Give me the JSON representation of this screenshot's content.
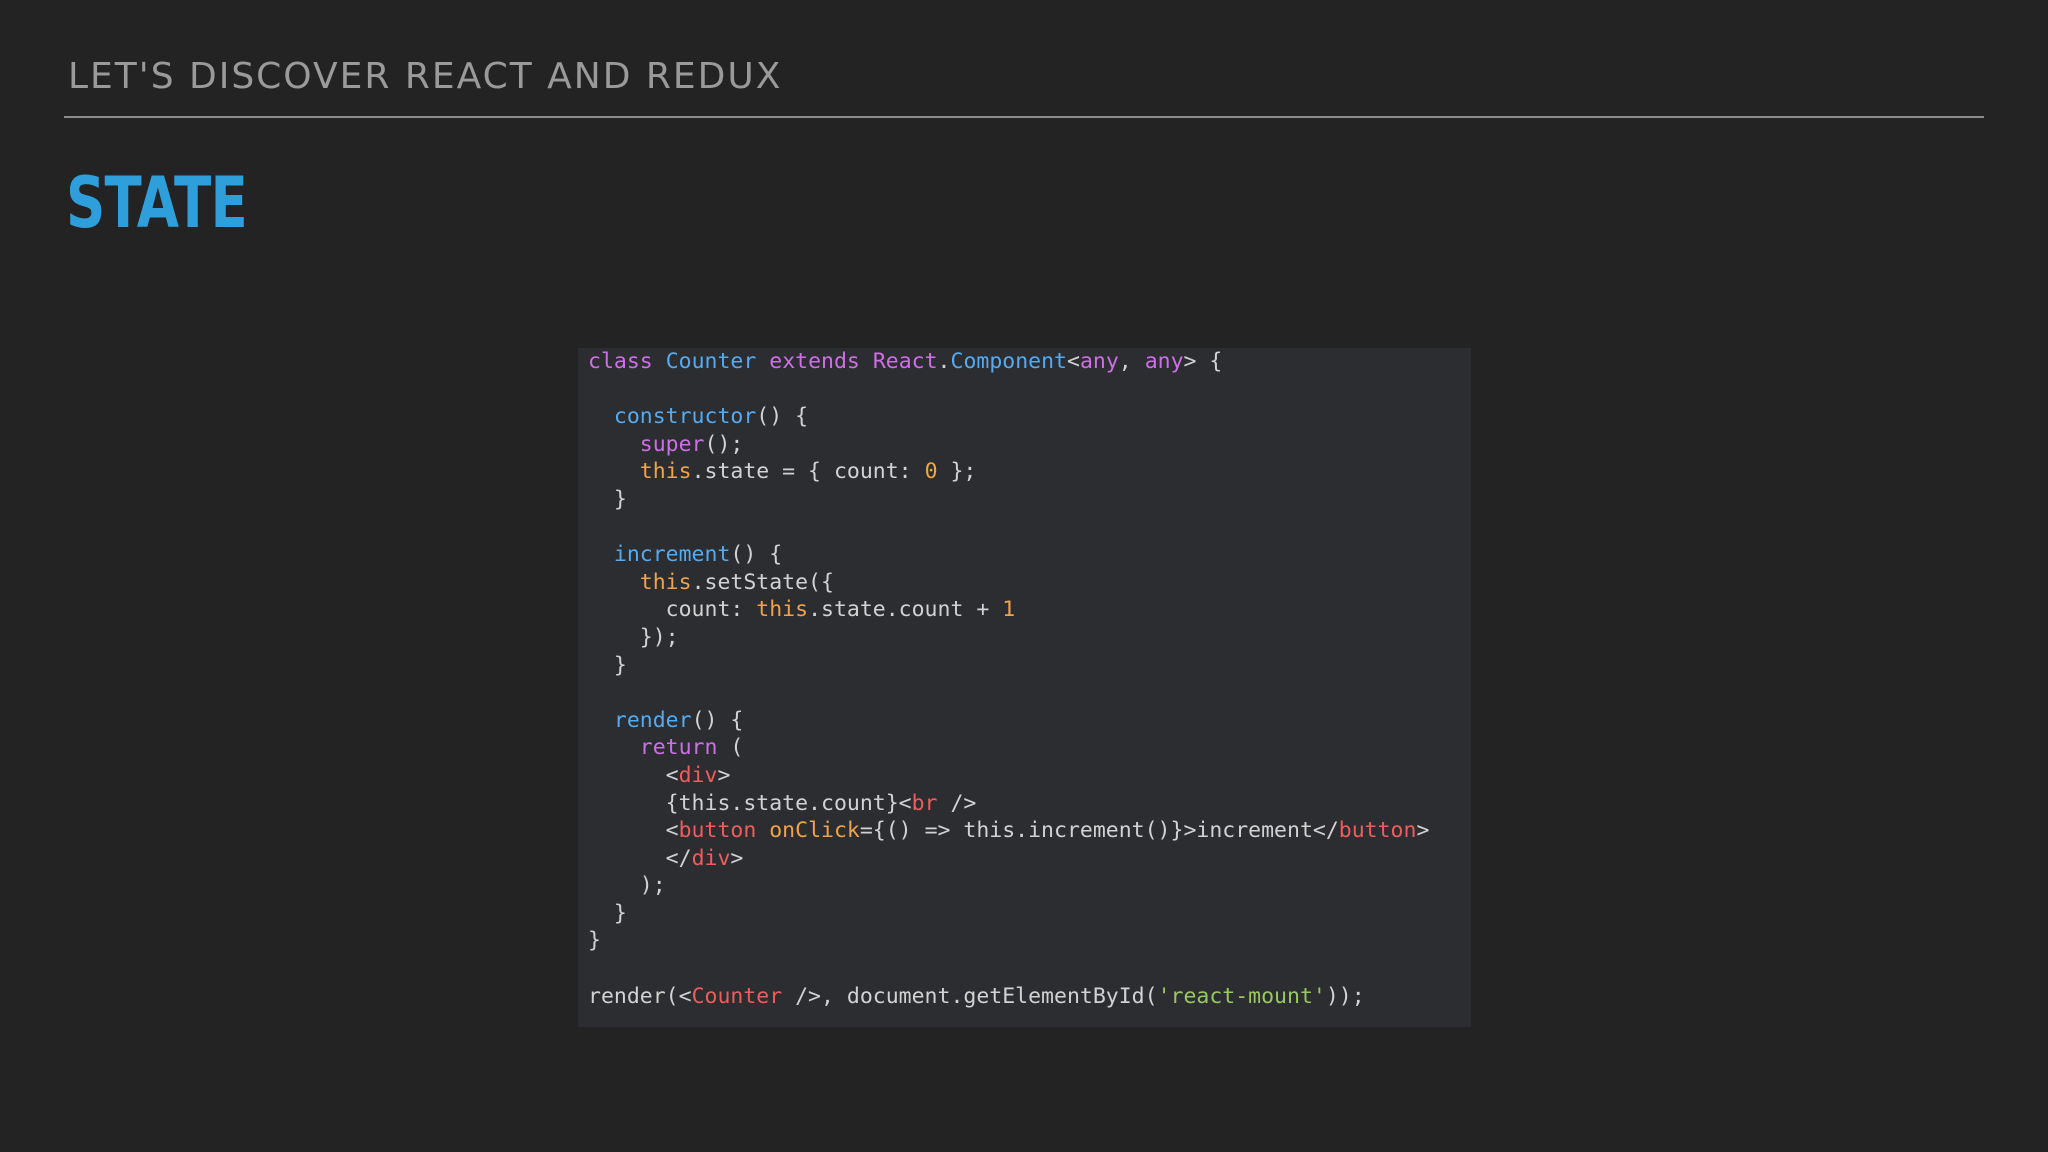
{
  "slide": {
    "header": "LET'S DISCOVER REACT AND REDUX",
    "title": "STATE"
  },
  "colors": {
    "background": "#232323",
    "header_text": "#9a9a9a",
    "title_accent": "#2f9fdc",
    "code_background": "#2b2d31",
    "keyword": "#cf6fe8",
    "function": "#55aaf0",
    "this_number": "#f2a24a",
    "jsx_tag": "#f05c5c",
    "string": "#99c760",
    "plain": "#d2d2d2"
  },
  "code": {
    "language": "tsx",
    "lines": [
      [
        [
          "kw",
          "class"
        ],
        [
          "p",
          " "
        ],
        [
          "fn",
          "Counter"
        ],
        [
          "p",
          " "
        ],
        [
          "kw",
          "extends"
        ],
        [
          "p",
          " "
        ],
        [
          "kw",
          "React"
        ],
        [
          "p",
          "."
        ],
        [
          "fn",
          "Component"
        ],
        [
          "p",
          "<"
        ],
        [
          "kw",
          "any"
        ],
        [
          "p",
          ", "
        ],
        [
          "kw",
          "any"
        ],
        [
          "p",
          "> {"
        ]
      ],
      [],
      [
        [
          "p",
          "  "
        ],
        [
          "fn",
          "constructor"
        ],
        [
          "p",
          "() {"
        ]
      ],
      [
        [
          "p",
          "    "
        ],
        [
          "kw",
          "super"
        ],
        [
          "p",
          "();"
        ]
      ],
      [
        [
          "p",
          "    "
        ],
        [
          "this",
          "this"
        ],
        [
          "p",
          ".state = { count: "
        ],
        [
          "num",
          "0"
        ],
        [
          "p",
          " };"
        ]
      ],
      [
        [
          "p",
          "  }"
        ]
      ],
      [],
      [
        [
          "p",
          "  "
        ],
        [
          "fn",
          "increment"
        ],
        [
          "p",
          "() {"
        ]
      ],
      [
        [
          "p",
          "    "
        ],
        [
          "this",
          "this"
        ],
        [
          "p",
          ".setState({"
        ]
      ],
      [
        [
          "p",
          "      count: "
        ],
        [
          "this",
          "this"
        ],
        [
          "p",
          ".state.count + "
        ],
        [
          "num",
          "1"
        ]
      ],
      [
        [
          "p",
          "    });"
        ]
      ],
      [
        [
          "p",
          "  }"
        ]
      ],
      [],
      [
        [
          "p",
          "  "
        ],
        [
          "fn",
          "render"
        ],
        [
          "p",
          "() {"
        ]
      ],
      [
        [
          "p",
          "    "
        ],
        [
          "kw",
          "return"
        ],
        [
          "p",
          " ("
        ]
      ],
      [
        [
          "p",
          "      <"
        ],
        [
          "tag",
          "div"
        ],
        [
          "p",
          ">"
        ]
      ],
      [
        [
          "p",
          "      {this.state.count}<"
        ],
        [
          "tag",
          "br"
        ],
        [
          "p",
          " />"
        ]
      ],
      [
        [
          "p",
          "      <"
        ],
        [
          "tag",
          "button"
        ],
        [
          "p",
          " "
        ],
        [
          "attr",
          "onClick"
        ],
        [
          "p",
          "={() => this.increment()}>increment</"
        ],
        [
          "tag",
          "button"
        ],
        [
          "p",
          ">"
        ]
      ],
      [
        [
          "p",
          "      </"
        ],
        [
          "tag",
          "div"
        ],
        [
          "p",
          ">"
        ]
      ],
      [
        [
          "p",
          "    );"
        ]
      ],
      [
        [
          "p",
          "  }"
        ]
      ],
      [
        [
          "p",
          "}"
        ]
      ],
      [],
      [
        [
          "p",
          "render(<"
        ],
        [
          "tag",
          "Counter"
        ],
        [
          "p",
          " />, document.getElementById("
        ],
        [
          "str",
          "'react-mount'"
        ],
        [
          "p",
          "));"
        ]
      ]
    ]
  }
}
